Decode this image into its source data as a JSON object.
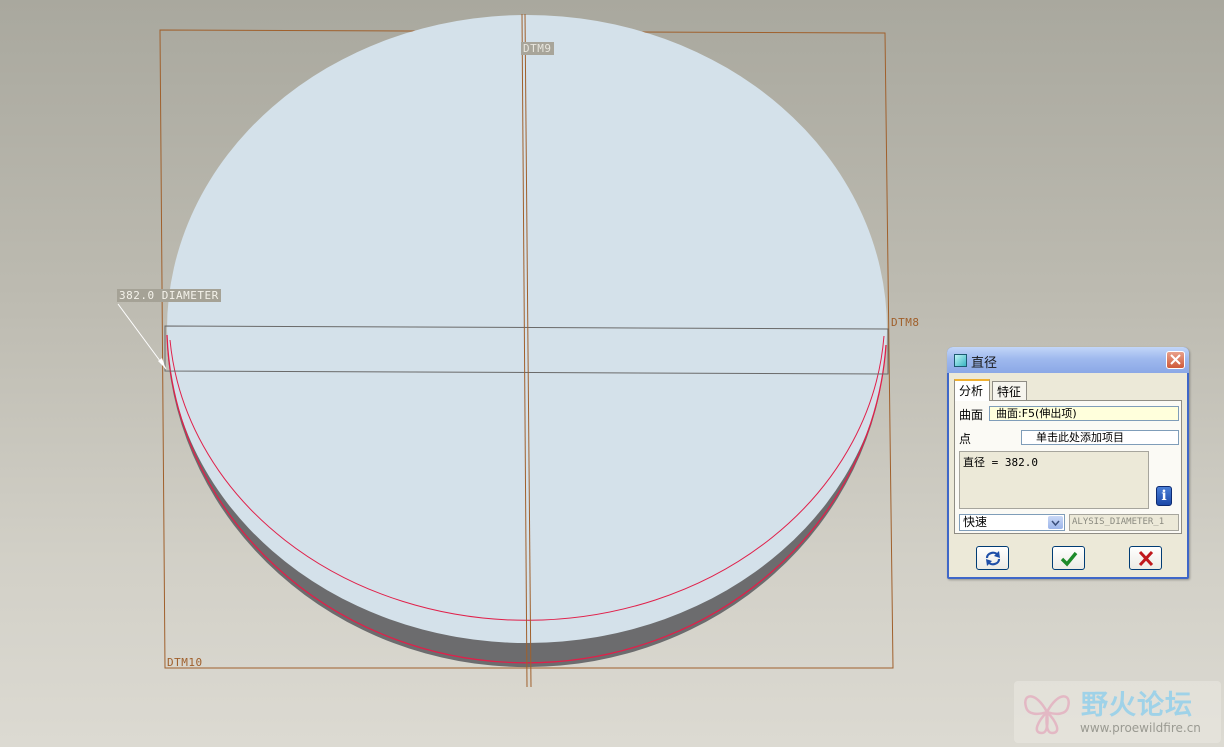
{
  "viewport": {
    "datum_labels": {
      "top": "DTM9",
      "right": "DTM8",
      "bottom": "DTM10"
    },
    "dimension_label": "382.0 DIAMETER"
  },
  "dialog": {
    "title": "直径",
    "tabs": [
      {
        "label": "分析",
        "active": true
      },
      {
        "label": "特征",
        "active": false
      }
    ],
    "surface_label": "曲面",
    "surface_value": "曲面:F5(伸出项)",
    "point_label": "点",
    "point_value": "单击此处添加项目",
    "result_text": "直径 = 382.0",
    "mode_value": "快速",
    "name_value": "ALYSIS_DIAMETER_1",
    "info_icon": "info-icon",
    "buttons": {
      "repeat": "repeat-icon",
      "ok": "check-icon",
      "cancel": "close-icon"
    }
  },
  "watermark": {
    "title": "野火论坛",
    "url": "www.proewildfire.cn"
  },
  "colors": {
    "disk_face": "#d4e1ea",
    "disk_side": "#6c6c6e",
    "edge_highlight": "#e0204a",
    "datum": "#a0602c",
    "dialog_border": "#3f67c8"
  }
}
